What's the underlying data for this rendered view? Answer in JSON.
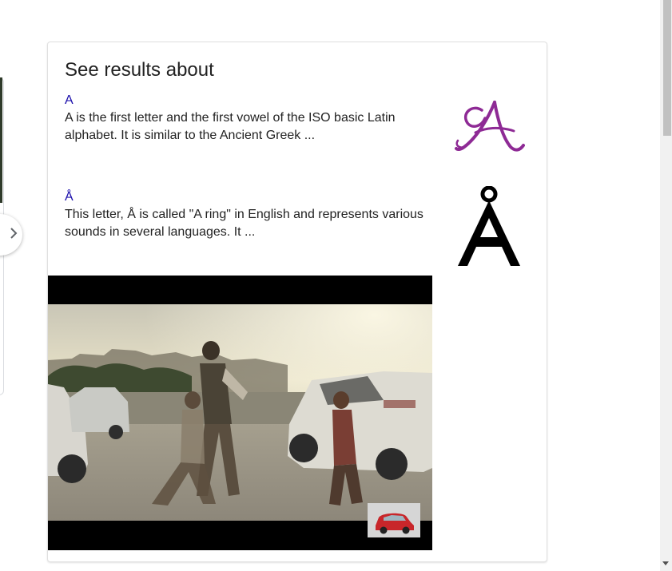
{
  "panel": {
    "title": "See results about",
    "results": [
      {
        "link": "A",
        "description": "A is the first letter and the first vowel of the ISO basic Latin alphabet. It is similar to the Ancient Greek ...",
        "thumbnail_icon": "script-a-letter-icon",
        "thumbnail_color": "#8e2a95"
      },
      {
        "link": "Å",
        "description": "This letter, Å is called \"A ring\" in English and represents various sounds in several languages. It ...",
        "thumbnail_icon": "a-ring-letter-icon",
        "thumbnail_color": "#000000"
      }
    ],
    "video": {
      "thumbnail_icon": "video-thumbnail",
      "overlay_icon": "red-car-thumbnail"
    }
  },
  "carousel": {
    "next_icon": "chevron-right-icon"
  },
  "colors": {
    "link": "#1a0dab",
    "text": "#222222",
    "border": "#e0e0e0"
  }
}
